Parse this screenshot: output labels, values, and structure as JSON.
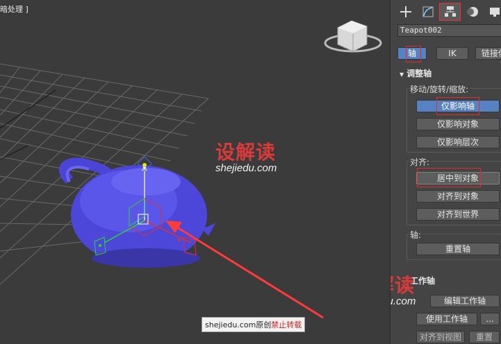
{
  "viewport": {
    "label": "暗处理 ]"
  },
  "watermark": {
    "logo": "设解读",
    "url": "shejiedu.com"
  },
  "credit": {
    "site": "shejiedu.com原创",
    "warning": "禁止转载"
  },
  "panel": {
    "tabs": [
      {
        "icon": "plus-icon"
      },
      {
        "icon": "modify-curve-icon"
      },
      {
        "icon": "hierarchy-icon",
        "active": true
      },
      {
        "icon": "motion-icon"
      },
      {
        "icon": "display-icon"
      }
    ],
    "object_name": "Teapot002",
    "subtabs": {
      "pivot": "轴",
      "ik": "IK",
      "link": "链接信"
    },
    "rollout_title": "调整轴",
    "move_group": {
      "label": "移动/旋转/缩放:",
      "affect_pivot": "仅影响轴",
      "affect_object": "仅影响对象",
      "affect_hierarchy": "仅影响层次"
    },
    "align_group": {
      "label": "对齐:",
      "center_to_object": "居中到对象",
      "align_to_object": "对齐到对象",
      "align_to_world": "对齐到世界"
    },
    "pivot_group": {
      "label": "轴:",
      "reset_pivot": "重置轴"
    },
    "working_pivot": {
      "title": "工作轴",
      "edit": "编辑工作轴",
      "use": "使用工作轴",
      "more": "...",
      "align_to_view": "对齐到视图",
      "reset": "重置"
    }
  }
}
